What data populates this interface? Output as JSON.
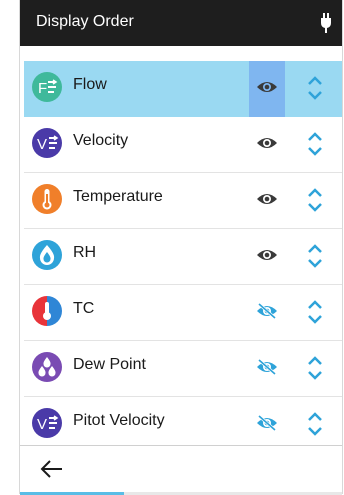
{
  "header": {
    "title": "Display Order",
    "status_icon": "power-plug-icon"
  },
  "colors": {
    "header_bg": "#1e1e1e",
    "selected_row": "#9ad9f2",
    "selected_eye_cell": "#7fb6f0",
    "visible_eye": "#3a3a3a",
    "hidden_eye": "#2ea3d9",
    "reorder": "#2ea3d9"
  },
  "items": [
    {
      "label": "Flow",
      "icon": "flow-icon",
      "visible": true,
      "selected": true
    },
    {
      "label": "Velocity",
      "icon": "velocity-icon",
      "visible": true,
      "selected": false
    },
    {
      "label": "Temperature",
      "icon": "temperature-icon",
      "visible": true,
      "selected": false
    },
    {
      "label": "RH",
      "icon": "humidity-drop-icon",
      "visible": true,
      "selected": false
    },
    {
      "label": "TC",
      "icon": "thermocouple-icon",
      "visible": false,
      "selected": false
    },
    {
      "label": "Dew Point",
      "icon": "dew-point-icon",
      "visible": false,
      "selected": false
    },
    {
      "label": "Pitot Velocity",
      "icon": "pitot-velocity-icon",
      "visible": false,
      "selected": false
    }
  ],
  "footer": {
    "back_icon": "back-arrow-icon"
  }
}
